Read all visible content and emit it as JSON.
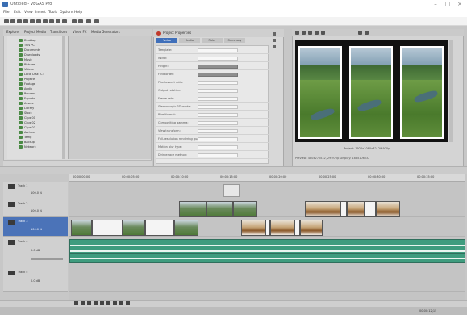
{
  "window": {
    "title": "Untitled - VEGAS Pro",
    "controls": {
      "minimize": "–",
      "maximize": "□",
      "close": "×"
    }
  },
  "menu": [
    "File",
    "Edit",
    "View",
    "Insert",
    "Tools",
    "Options",
    "Help"
  ],
  "explorer": {
    "tabs": [
      "Explorer",
      "Project Media",
      "Transitions",
      "Video FX",
      "Media Generators"
    ],
    "tree": [
      "Desktop",
      "This PC",
      "Documents",
      "Downloads",
      "Music",
      "Pictures",
      "Videos",
      "Local Disk (C:)",
      "Projects",
      "Footage",
      "Audio",
      "Renders",
      "Exports",
      "Assets",
      "Library",
      "Stock",
      "Clips 01",
      "Clips 02",
      "Clips 03",
      "Archive",
      "Temp",
      "Backup",
      "Network"
    ]
  },
  "properties": {
    "title": "Project Properties",
    "tabs": [
      "Video",
      "Audio",
      "Ruler",
      "Summary"
    ],
    "active_tab": "Video",
    "rows": [
      "Template:",
      "Width:",
      "Height:",
      "Field order:",
      "Pixel aspect ratio:",
      "Output rotation:",
      "Frame rate:",
      "Stereoscopic 3D mode:",
      "Pixel format:",
      "Compositing gamma:",
      "View transform:",
      "Full-resolution rendering quality:",
      "Motion blur type:",
      "Deinterlace method:"
    ]
  },
  "preview": {
    "info_line": "Project: 1920x1080x32, 29.970p",
    "info_line_2": "Preview: 480x270x32, 29.970p   Display: 188x106x32"
  },
  "timeline": {
    "ruler_labels": [
      "00:00:00;00",
      "00:00:05;00",
      "00:00:10;00",
      "00:00:15;00",
      "00:00:20;00",
      "00:00:25;00",
      "00:00:30;00",
      "00:00:35;00"
    ],
    "tracks": [
      {
        "label": "Track 1",
        "level": "100.0 %"
      },
      {
        "label": "Track 2",
        "level": "100.0 %"
      },
      {
        "label": "Track 3",
        "level": "100.0 %"
      },
      {
        "label": "Track 4",
        "level": "0.0 dB"
      },
      {
        "label": "Track 5",
        "level": "0.0 dB"
      }
    ],
    "selected_track": 2
  },
  "status": {
    "time": "00:00:12;15"
  },
  "colors": {
    "accent": "#3f6fba",
    "audio_clip": "#3f9c7e",
    "record": "#c0392b"
  },
  "icons": [
    "app-icon",
    "minimize-icon",
    "maximize-icon",
    "close-icon",
    "folder-icon",
    "play-icon",
    "stop-icon",
    "loop-icon",
    "record-icon"
  ]
}
